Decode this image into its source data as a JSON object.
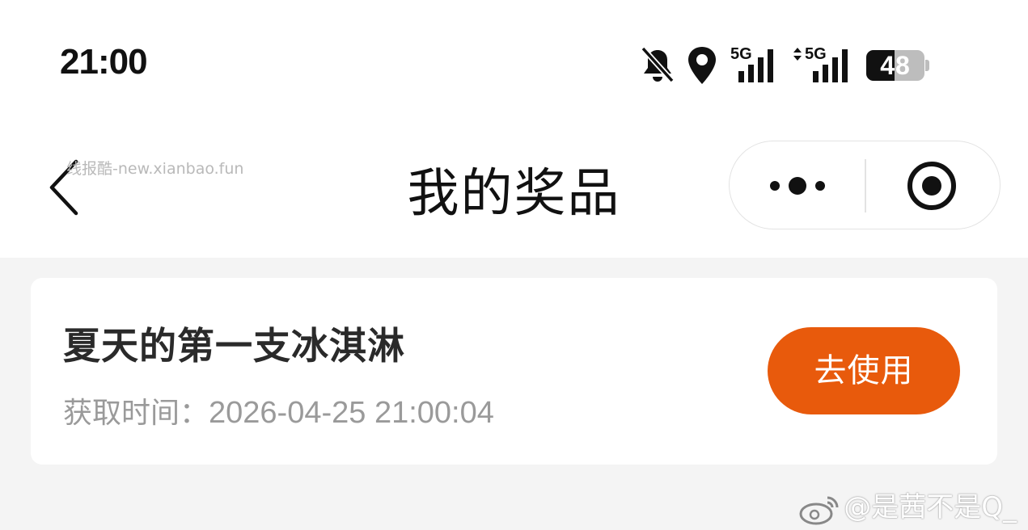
{
  "status_bar": {
    "time": "21:00",
    "icons": [
      "bell-off-icon",
      "location-pin-icon",
      "signal-5g-icon",
      "signal-5g-data-icon",
      "battery-icon"
    ],
    "signal_label_1": "5G",
    "signal_label_2": "5G",
    "battery_level": "48",
    "battery_fraction": 0.48
  },
  "nav": {
    "back_icon": "chevron-left-icon",
    "watermark": "线报酷-new.xianbao.fun",
    "title": "我的奖品",
    "more_icon": "more-dots-icon",
    "close_icon": "target-circle-icon"
  },
  "prize": {
    "name": "夏天的第一支冰淇淋",
    "obtain_label": "获取时间：",
    "obtain_time": "2026-04-25 21:00:04",
    "use_button_label": "去使用"
  },
  "watermark_corner": "@是茜不是Q_",
  "colors": {
    "accent": "#e85a0c",
    "page_bg": "#f4f4f4",
    "card_bg": "#ffffff",
    "muted_text": "#9a9a9a"
  }
}
